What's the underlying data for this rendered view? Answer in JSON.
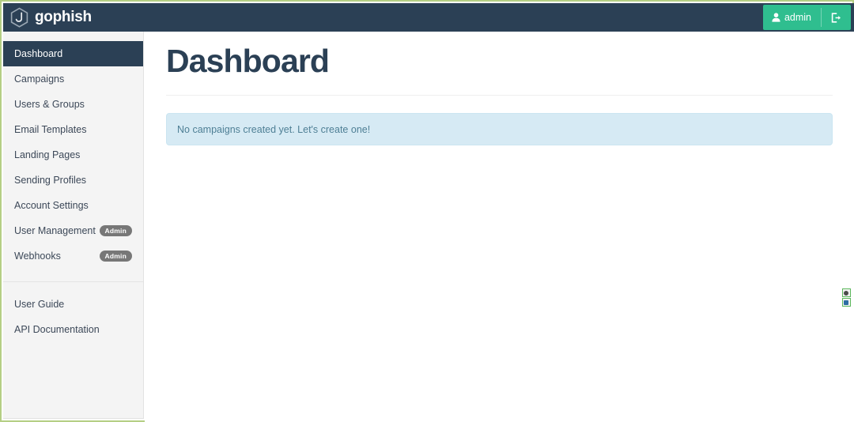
{
  "brand": {
    "name": "gophish",
    "logo_icon": "hexagon-fishhook-icon"
  },
  "navbar": {
    "user": {
      "label": "admin",
      "user_icon": "user-icon",
      "logout_icon": "sign-out-icon"
    }
  },
  "sidebar": {
    "items": [
      {
        "label": "Dashboard",
        "active": true,
        "badge": null
      },
      {
        "label": "Campaigns",
        "active": false,
        "badge": null
      },
      {
        "label": "Users & Groups",
        "active": false,
        "badge": null
      },
      {
        "label": "Email Templates",
        "active": false,
        "badge": null
      },
      {
        "label": "Landing Pages",
        "active": false,
        "badge": null
      },
      {
        "label": "Sending Profiles",
        "active": false,
        "badge": null
      },
      {
        "label": "Account Settings",
        "active": false,
        "badge": null
      },
      {
        "label": "User Management",
        "active": false,
        "badge": "Admin"
      },
      {
        "label": "Webhooks",
        "active": false,
        "badge": "Admin"
      }
    ],
    "footer_items": [
      {
        "label": "User Guide"
      },
      {
        "label": "API Documentation"
      }
    ]
  },
  "main": {
    "title": "Dashboard",
    "alert": {
      "message": "No campaigns created yet. Let's create one!",
      "type": "info"
    }
  },
  "edge_widget": {
    "buttons": [
      {
        "icon": "gear-circle-icon"
      },
      {
        "icon": "square-target-icon"
      }
    ]
  },
  "colors": {
    "navbar_bg": "#2b4055",
    "accent_green": "#2fbe8f",
    "sidebar_bg": "#f4f4f4",
    "title_color": "#2b4055",
    "alert_bg": "#d6eaf4",
    "alert_text": "#4e7f95",
    "badge_bg": "#777777",
    "page_border": "#b5cf85"
  }
}
